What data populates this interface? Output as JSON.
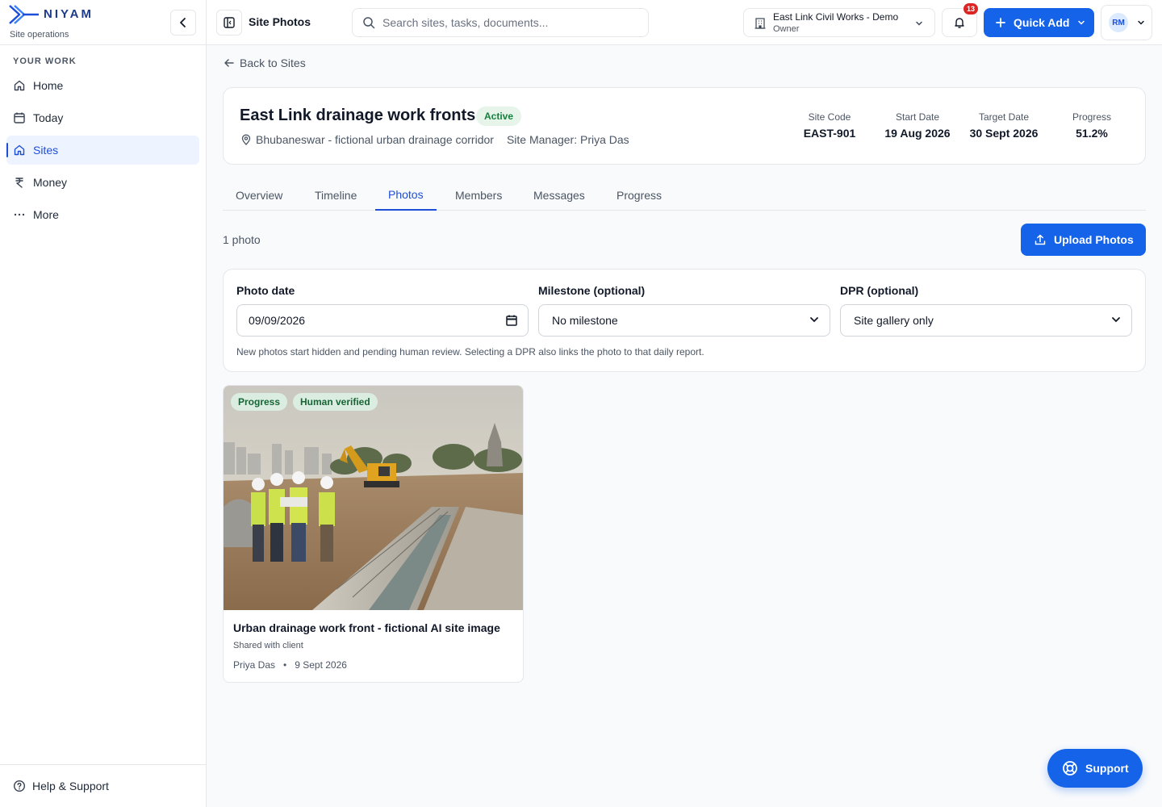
{
  "brand": {
    "name": "NIYAM",
    "subtitle": "Site operations"
  },
  "sidebar": {
    "section_label": "YOUR WORK",
    "items": [
      {
        "label": "Home",
        "icon": "home-icon",
        "active": false
      },
      {
        "label": "Today",
        "icon": "calendar-icon",
        "active": false
      },
      {
        "label": "Sites",
        "icon": "home-icon",
        "active": true
      },
      {
        "label": "Money",
        "icon": "rupee-icon",
        "active": false
      },
      {
        "label": "More",
        "icon": "more-icon",
        "active": false
      }
    ],
    "footer": "Help & Support"
  },
  "topbar": {
    "page_title": "Site Photos",
    "search_placeholder": "Search sites, tasks, documents...",
    "org_name": "East Link Civil Works - Demo",
    "org_role": "Owner",
    "notification_count": "13",
    "quick_add_label": "Quick Add",
    "user_initials": "RM"
  },
  "back_label": "Back to Sites",
  "site": {
    "name": "East Link drainage work fronts",
    "status": "Active",
    "location": "Bhubaneswar - fictional urban drainage corridor",
    "manager": "Site Manager: Priya Das",
    "stats": [
      {
        "label": "Site Code",
        "value": "EAST-901"
      },
      {
        "label": "Start Date",
        "value": "19 Aug 2026"
      },
      {
        "label": "Target Date",
        "value": "30 Sept 2026"
      },
      {
        "label": "Progress",
        "value": "51.2%"
      }
    ]
  },
  "tabs": [
    "Overview",
    "Timeline",
    "Photos",
    "Members",
    "Messages",
    "Progress"
  ],
  "active_tab": "Photos",
  "photos_count_label": "1 photo",
  "upload_label": "Upload Photos",
  "form": {
    "photo_date_label": "Photo date",
    "photo_date_value": "09/09/2026",
    "milestone_label": "Milestone (optional)",
    "milestone_value": "No milestone",
    "dpr_label": "DPR (optional)",
    "dpr_value": "Site gallery only",
    "note": "New photos start hidden and pending human review. Selecting a DPR also links the photo to that daily report."
  },
  "photo": {
    "tags": [
      "Progress",
      "Human verified"
    ],
    "title": "Urban drainage work front - fictional AI site image",
    "visibility": "Shared with client",
    "author": "Priya Das",
    "separator": "•",
    "date": "9 Sept 2026"
  },
  "support_label": "Support",
  "colors": {
    "primary": "#1463e8",
    "active_nav_bg": "#eef4ff",
    "badge_green": "#15803d",
    "notification_red": "#dc2626"
  }
}
